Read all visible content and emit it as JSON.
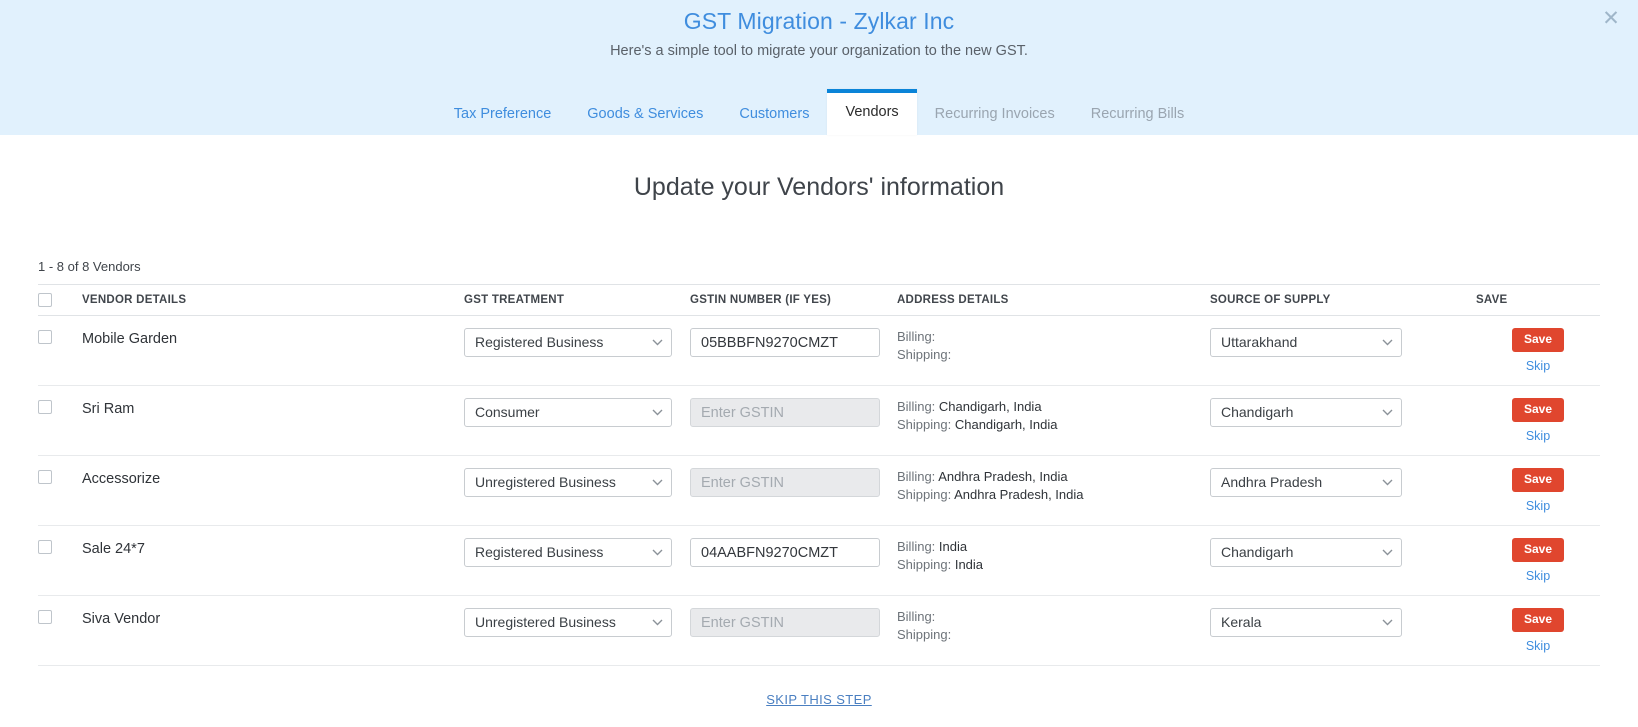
{
  "banner": {
    "title": "GST Migration - Zylkar Inc",
    "subtitle": "Here's a simple tool to migrate your organization to the new GST.",
    "close_label": "✕"
  },
  "tabs": [
    {
      "label": "Tax Preference",
      "state": "link"
    },
    {
      "label": "Goods & Services",
      "state": "link"
    },
    {
      "label": "Customers",
      "state": "link"
    },
    {
      "label": "Vendors",
      "state": "active"
    },
    {
      "label": "Recurring Invoices",
      "state": "disabled"
    },
    {
      "label": "Recurring Bills",
      "state": "disabled"
    }
  ],
  "page": {
    "heading": "Update your Vendors' information",
    "record_count": "1 - 8 of 8 Vendors"
  },
  "table": {
    "headers": {
      "vendor_details": "VENDOR DETAILS",
      "gst_treatment": "GST TREATMENT",
      "gstin_number": "GSTIN NUMBER (IF YES)",
      "address_details": "ADDRESS DETAILS",
      "source_of_supply": "SOURCE OF SUPPLY",
      "save": "SAVE"
    },
    "labels": {
      "billing": "Billing:",
      "shipping": "Shipping:",
      "save_button": "Save",
      "skip_link": "Skip",
      "gstin_placeholder": "Enter GSTIN",
      "chevron": "⌄"
    },
    "rows": [
      {
        "vendor": "Mobile Garden",
        "gst_treatment": "Registered Business",
        "gstin_value": "05BBBFN9270CMZT",
        "gstin_enabled": true,
        "billing": "",
        "shipping": "",
        "source_of_supply": "Uttarakhand"
      },
      {
        "vendor": "Sri Ram",
        "gst_treatment": "Consumer",
        "gstin_value": "",
        "gstin_enabled": false,
        "billing": "Chandigarh, India",
        "shipping": "Chandigarh, India",
        "source_of_supply": "Chandigarh"
      },
      {
        "vendor": "Accessorize",
        "gst_treatment": "Unregistered Business",
        "gstin_value": "",
        "gstin_enabled": false,
        "billing": "Andhra Pradesh, India",
        "shipping": "Andhra Pradesh, India",
        "source_of_supply": "Andhra Pradesh"
      },
      {
        "vendor": "Sale 24*7",
        "gst_treatment": "Registered Business",
        "gstin_value": "04AABFN9270CMZT",
        "gstin_enabled": true,
        "billing": "India",
        "shipping": "India",
        "source_of_supply": "Chandigarh"
      },
      {
        "vendor": "Siva Vendor",
        "gst_treatment": "Unregistered Business",
        "gstin_value": "",
        "gstin_enabled": false,
        "billing": "",
        "shipping": "",
        "source_of_supply": "Kerala"
      }
    ]
  },
  "footer": {
    "skip_step": "SKIP THIS STEP"
  },
  "colors": {
    "banner_bg": "#e1f1fd",
    "link_blue": "#3f8dde",
    "active_tab_border": "#0a84d8",
    "save_red": "#e0462e",
    "disabled_tab": "#9aa5b0"
  }
}
